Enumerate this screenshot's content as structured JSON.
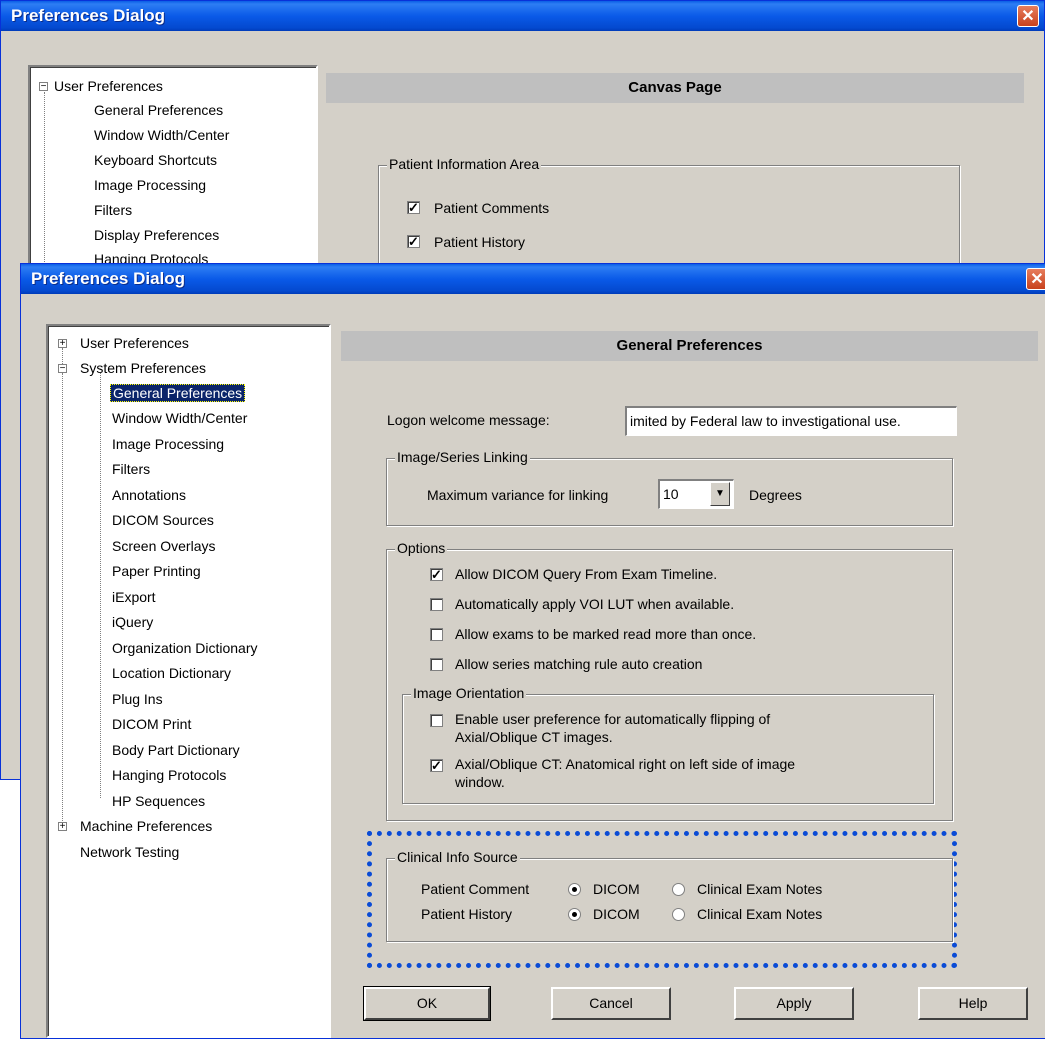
{
  "back_window": {
    "title": "Preferences Dialog",
    "tree": [
      "User Preferences",
      "General Preferences",
      "Window Width/Center",
      "Keyboard Shortcuts",
      "Image Processing",
      "Filters",
      "Display Preferences",
      "Hanging Protocols"
    ],
    "page_header": "Canvas Page",
    "group_title": "Patient Information Area",
    "checkboxes": [
      {
        "label": "Patient Comments",
        "checked": true
      },
      {
        "label": "Patient History",
        "checked": true
      }
    ]
  },
  "front_window": {
    "title": "Preferences Dialog",
    "tree": {
      "user_prefs": "User Preferences",
      "system_prefs": "System Preferences",
      "system_children": [
        "General Preferences",
        "Window Width/Center",
        "Image Processing",
        "Filters",
        "Annotations",
        "DICOM Sources",
        "Screen Overlays",
        "Paper Printing",
        "iExport",
        "iQuery",
        "Organization Dictionary",
        "Location Dictionary",
        "Plug Ins",
        "DICOM Print",
        "Body Part Dictionary",
        "Hanging Protocols",
        "HP Sequences"
      ],
      "machine_prefs": "Machine Preferences",
      "network_testing": "Network Testing"
    },
    "page_header": "General Preferences",
    "logon_label": "Logon welcome message:",
    "logon_value": "imited by Federal law to investigational use.",
    "linking": {
      "title": "Image/Series Linking",
      "label": "Maximum variance for linking",
      "value": "10",
      "unit": "Degrees"
    },
    "options": {
      "title": "Options",
      "items": [
        {
          "label": "Allow DICOM Query From Exam Timeline.",
          "checked": true
        },
        {
          "label": "Automatically apply VOI LUT when available.",
          "checked": false
        },
        {
          "label": "Allow exams to be marked read more than once.",
          "checked": false
        },
        {
          "label": "Allow series matching rule auto creation",
          "checked": false
        }
      ],
      "orientation": {
        "title": "Image Orientation",
        "items": [
          {
            "line1": "Enable user preference for automatically flipping of",
            "line2": "Axial/Oblique CT images.",
            "checked": false
          },
          {
            "line1": "Axial/Oblique CT: Anatomical right on left side of image",
            "line2": "window.",
            "checked": true
          }
        ]
      }
    },
    "clinical": {
      "title": "Clinical Info Source",
      "rows": [
        {
          "label": "Patient Comment",
          "opt1": "DICOM",
          "opt2": "Clinical Exam Notes",
          "selected": "DICOM"
        },
        {
          "label": "Patient History",
          "opt1": "DICOM",
          "opt2": "Clinical Exam Notes",
          "selected": "DICOM"
        }
      ],
      "highlight_color": "#0a4bd6"
    },
    "buttons": {
      "ok": "OK",
      "cancel": "Cancel",
      "apply": "Apply",
      "help": "Help"
    }
  },
  "colors": {
    "titlebar": "#0a5ae8",
    "face": "#d4d0c8",
    "selection": "#0a246a"
  }
}
